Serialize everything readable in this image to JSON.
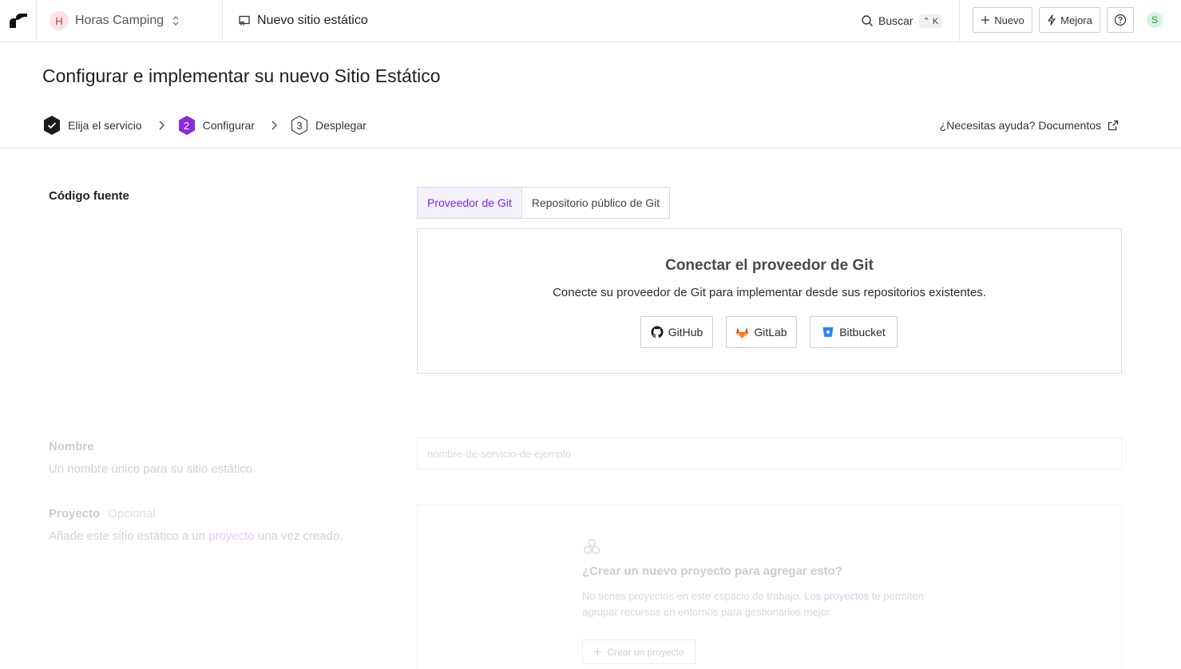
{
  "topbar": {
    "workspace": {
      "initial": "H",
      "name": "Horas Camping"
    },
    "breadcrumb": "Nuevo sitio estático",
    "search": {
      "label": "Buscar",
      "shortcut": "⌃ K"
    },
    "new_label": "Nuevo",
    "upgrade_label": "Mejora",
    "user_initial": "S"
  },
  "header": {
    "title": "Configurar e implementar su nuevo Sitio Estático",
    "steps": [
      {
        "label": "Elija el servicio",
        "state": "done"
      },
      {
        "number": "2",
        "label": "Configurar",
        "state": "active"
      },
      {
        "number": "3",
        "label": "Desplegar",
        "state": "pending"
      }
    ],
    "help_label": "¿Necesitas ayuda? Documentos"
  },
  "source": {
    "label": "Código fuente",
    "tabs": [
      "Proveedor de Git",
      "Repositorio público de Git"
    ],
    "connect_title": "Conectar el proveedor de Git",
    "connect_desc": "Conecte su proveedor de Git para implementar desde sus repositorios existentes.",
    "providers": [
      "GitHub",
      "GitLab",
      "Bitbucket"
    ]
  },
  "name_section": {
    "label": "Nombre",
    "description": "Un nombre único para su sitio estático.",
    "placeholder": "nombre-de-servicio-de-ejemplo"
  },
  "project_section": {
    "label": "Proyecto",
    "optional": "Opcional",
    "desc_before": "Añade este sitio estático a un ",
    "desc_link": "proyecto",
    "desc_after": " una vez creado.",
    "empty_title": "¿Crear un nuevo proyecto para agregar esto?",
    "empty_desc_before": "No tienes proyectos en este espacio de trabajo. ",
    "empty_desc_link": "Los proyectos",
    "empty_desc_after": " te permiten agrupar recursos en entornos para gestionarlos mejor.",
    "create_label": "Crear un proyecto"
  },
  "colors": {
    "accent": "#7b2bdb",
    "border": "#dcdcdc",
    "gitlab": "#e24329",
    "bitbucket": "#2684ff"
  }
}
